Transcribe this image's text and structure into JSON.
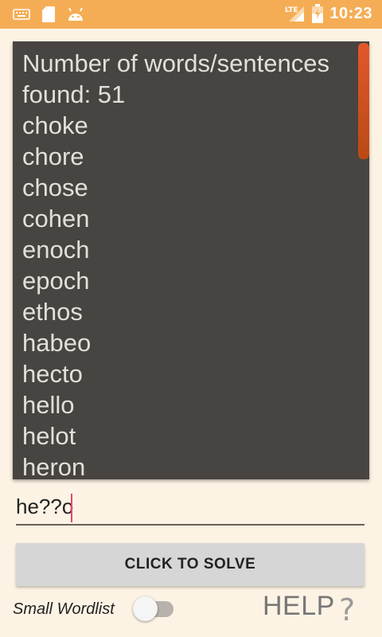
{
  "status_bar": {
    "time": "10:23",
    "network": "LTE",
    "icons": [
      "keyboard-icon",
      "sd-card-icon",
      "android-icon",
      "signal-icon",
      "battery-icon"
    ]
  },
  "results": {
    "header_line1": "Number of words/sentences",
    "header_line2": "found: 51",
    "words": [
      "choke",
      "chore",
      "chose",
      "cohen",
      "enoch",
      "epoch",
      "ethos",
      "habeo",
      "hecto",
      "hello",
      "helot",
      "heron"
    ]
  },
  "query": {
    "value": "he??o"
  },
  "solve_button": {
    "label": "CLICK TO SOLVE"
  },
  "wordlist_toggle": {
    "label": "Small Wordlist",
    "state": "off"
  },
  "help": {
    "label": "HELP",
    "icon": "?"
  },
  "colors": {
    "status_bar": "#f5ad55",
    "background": "#fdf3e4",
    "panel": "#474441",
    "scrollbar": "#e2582a",
    "caret": "#e8457a"
  }
}
